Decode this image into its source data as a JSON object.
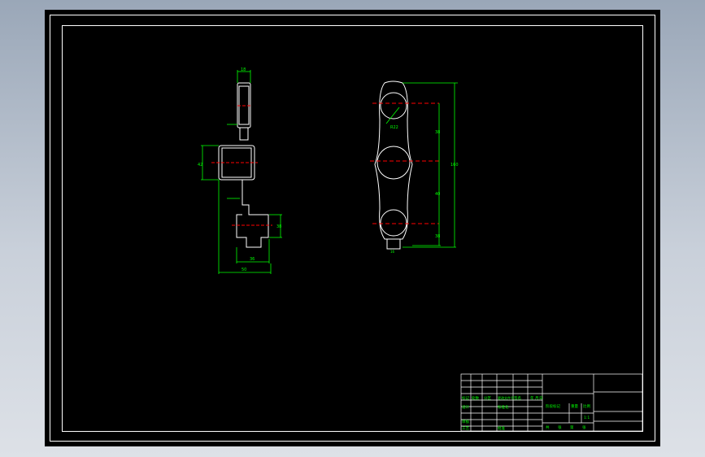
{
  "drawing": {
    "dimensions_left": [
      "18",
      "42",
      "38",
      "36",
      "50"
    ],
    "dimensions_right": [
      "R22",
      "38",
      "40",
      "38",
      "160"
    ],
    "bottom_stub_label": "16"
  },
  "title_block": {
    "rows_left": [
      "标记",
      "处数",
      "分区",
      "更改文件号",
      "签名",
      "年",
      "月",
      "日"
    ],
    "designer": "设计",
    "standardize": "标准化",
    "stage_mark": "阶段标记",
    "weight": "重量",
    "ratio": "比例",
    "scale_value": "1:1",
    "reviewer": "审核",
    "process": "工艺",
    "approve": "批准",
    "sheet_total": "共",
    "sheet_of": "张",
    "sheet_no": "第",
    "sheet_unit": "张"
  },
  "colors": {
    "lines": "#ffffff",
    "dimensions": "#00ff00",
    "background": "#000000"
  }
}
